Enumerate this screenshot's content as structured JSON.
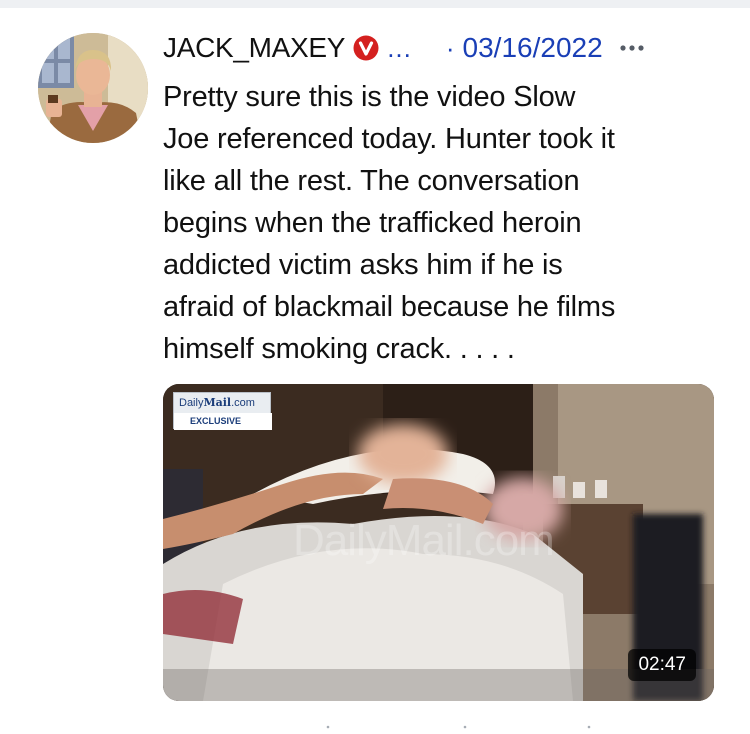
{
  "post": {
    "username": "JACK_MAXEY",
    "name_overflow": "...",
    "separator": "·",
    "date": "03/16/2022",
    "text": "Pretty sure this is the video Slow\nJoe referenced today. Hunter took it\nlike all the rest. The conversation\nbegins when the trafficked heroin\naddicted victim asks him if he is\nafraid of blackmail because he films\nhimself smoking crack. . . . ."
  },
  "video": {
    "source_logo_prefix": "Daily",
    "source_logo_brand": "Mail",
    "source_logo_suffix": ".com",
    "source_tag": "EXCLUSIVE",
    "watermark": "DailyMail.com",
    "duration": "02:47"
  },
  "icons": {
    "verified": "verified-badge-icon",
    "more": "more-dots-icon",
    "play": "video-thumbnail"
  },
  "colors": {
    "link_blue": "#1a3fb6",
    "badge_red": "#d4201f",
    "text": "#111111"
  }
}
